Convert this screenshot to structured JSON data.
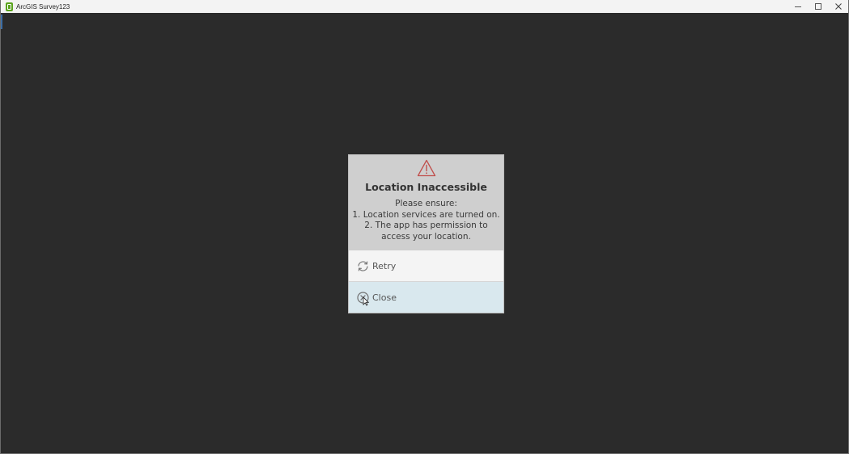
{
  "window": {
    "title": "ArcGIS Survey123",
    "controls": {
      "minimize_icon": "minimize-icon",
      "maximize_icon": "maximize-icon",
      "close_icon": "close-icon"
    }
  },
  "dialog": {
    "icon": "warning-icon",
    "title": "Location Inaccessible",
    "body_lines": [
      "Please ensure:",
      "1. Location services are turned on.",
      "2. The app has permission to",
      "access your location."
    ],
    "buttons": {
      "retry": {
        "label": "Retry",
        "icon": "refresh-icon"
      },
      "close": {
        "label": "Close",
        "icon": "close-circle-icon"
      }
    }
  },
  "colors": {
    "background": "#2b2b2b",
    "dialog_header": "#cfcfcf",
    "retry_bg": "#f4f4f4",
    "close_bg": "#d9e8ee",
    "warning": "#c0504d",
    "app_icon": "#5aa31e"
  }
}
